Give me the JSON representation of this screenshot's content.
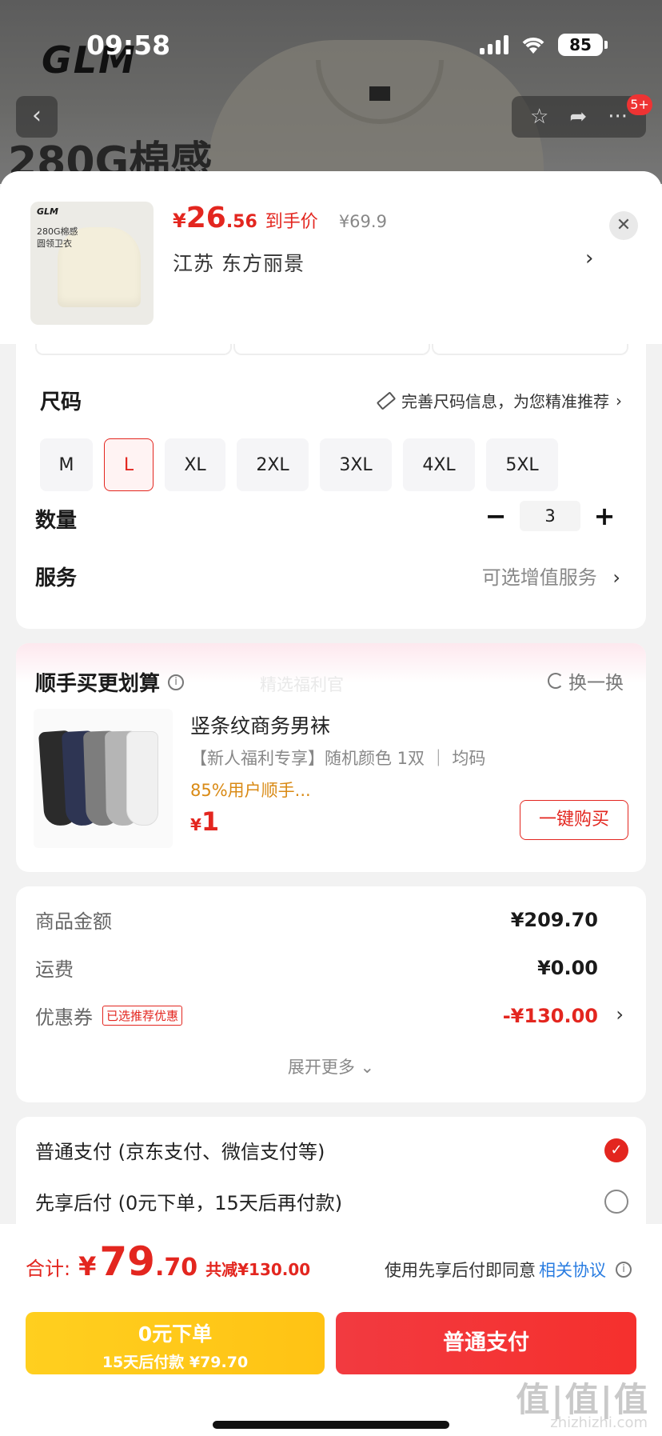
{
  "status_bar": {
    "time": "09:58",
    "battery": "85"
  },
  "background_page": {
    "logo": "GLM",
    "headline": "280G棉感",
    "cart_badge": "5+"
  },
  "product": {
    "thumb_logo": "GLM",
    "thumb_lines": [
      "280G棉感",
      "圆领卫衣"
    ],
    "price_symbol": "¥",
    "price_int": "26",
    "price_dec": ".56",
    "price_label": "到手价",
    "original_price": "¥69.9",
    "address": "江苏  东方丽景"
  },
  "size": {
    "title": "尺码",
    "hint": "完善尺码信息，为您精准推荐",
    "options": [
      "M",
      "L",
      "XL",
      "2XL",
      "3XL",
      "4XL",
      "5XL"
    ],
    "selected": "L"
  },
  "quantity": {
    "title": "数量",
    "value": "3",
    "minus": "−",
    "plus": "+"
  },
  "service": {
    "title": "服务",
    "value": "可选增值服务"
  },
  "cross_sell": {
    "title": "顺手买更划算",
    "watermark": "精选福利官",
    "refresh": "换一换",
    "name": "竖条纹商务男袜",
    "spec": "【新人福利专享】随机颜色 1双  ｜  均码",
    "promo": "85%用户顺手...",
    "price_symbol": "¥",
    "price": "1",
    "buy_button": "一键购买"
  },
  "amounts": {
    "rows": [
      {
        "label": "商品金额",
        "value": "¥209.70"
      },
      {
        "label": "运费",
        "value": "¥0.00"
      },
      {
        "label": "优惠券",
        "tag": "已选推荐优惠",
        "value": "-¥130.00"
      }
    ],
    "expand": "展开更多 ⌄"
  },
  "payment": {
    "options": [
      {
        "label": "普通支付 (京东支付、微信支付等)",
        "selected": true
      },
      {
        "label": "先享后付 (0元下单，15天后再付款)",
        "selected": false
      }
    ]
  },
  "footer": {
    "total_label": "合计:",
    "total_symbol": "¥",
    "total_int": "79",
    "total_dec": ".70",
    "total_saved": "共减¥130.00",
    "agree_text": "使用先享后付即同意",
    "agree_link": "相关协议",
    "later_line1": "0元下单",
    "later_line2": "15天后付款 ¥79.70",
    "pay_button": "普通支付",
    "watermark": "值|值|值",
    "watermark_sub": "zhizhizhi.com"
  },
  "colors": {
    "accent": "#e3261f",
    "yellow_button": "#ffc314",
    "link": "#2a7de1"
  }
}
